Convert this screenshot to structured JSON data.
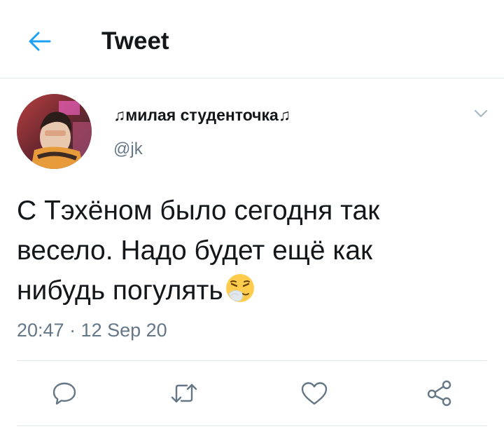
{
  "header": {
    "title": "Tweet",
    "back_icon": "arrow-left-icon",
    "accent_color": "#1da1f2"
  },
  "tweet": {
    "display_name": "♫милая студенточка♫",
    "handle": "@jk",
    "text_lines": [
      "С Тэхёном было сегодня так",
      "весело. Надо будет ещё как",
      "нибудь погулять"
    ],
    "emoji": "sneezing-face-emoji",
    "timestamp": "20:47 · 12 Sep 20"
  },
  "actions": [
    {
      "name": "reply",
      "icon": "comment-icon"
    },
    {
      "name": "retweet",
      "icon": "retweet-icon"
    },
    {
      "name": "like",
      "icon": "heart-icon"
    },
    {
      "name": "share",
      "icon": "share-icon"
    }
  ],
  "colors": {
    "text": "#14171a",
    "secondary": "#657786",
    "divider": "#e1e8ed",
    "icon": "#657786"
  }
}
